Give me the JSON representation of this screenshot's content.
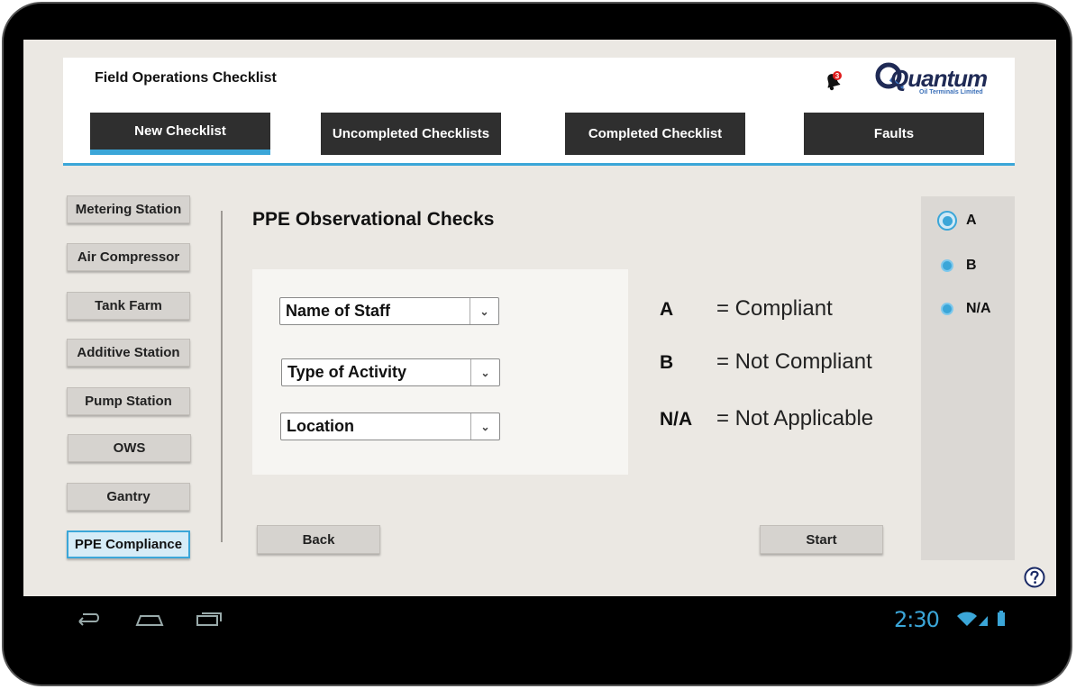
{
  "app": {
    "title": "Field Operations Checklist"
  },
  "logo": {
    "text": "Quantum",
    "subtitle": "Oil Terminals Limited"
  },
  "notifications": {
    "count": "3"
  },
  "tabs": [
    {
      "label": "New Checklist"
    },
    {
      "label": "Uncompleted Checklists"
    },
    {
      "label": "Completed Checklist"
    },
    {
      "label": "Faults"
    }
  ],
  "sidebar": {
    "items": [
      {
        "label": "Metering Station"
      },
      {
        "label": "Air Compressor"
      },
      {
        "label": "Tank Farm"
      },
      {
        "label": "Additive Station"
      },
      {
        "label": "Pump Station"
      },
      {
        "label": "OWS"
      },
      {
        "label": "Gantry"
      },
      {
        "label": "PPE Compliance"
      }
    ]
  },
  "main": {
    "title": "PPE Observational Checks",
    "selects": [
      {
        "value": "Name of Staff"
      },
      {
        "value": "Type of Activity"
      },
      {
        "value": "Location"
      }
    ],
    "legend": [
      {
        "key": "A",
        "value": "= Compliant"
      },
      {
        "key": "B",
        "value": "= Not Compliant"
      },
      {
        "key": "N/A",
        "value": "= Not Applicable"
      }
    ],
    "back_label": "Back",
    "start_label": "Start"
  },
  "rating": {
    "options": [
      {
        "label": "A",
        "selected": true
      },
      {
        "label": "B",
        "selected": false
      },
      {
        "label": "N/A",
        "selected": false
      }
    ]
  },
  "status_bar": {
    "time": "2:30"
  },
  "colors": {
    "accent": "#3ba6d8",
    "tab_bg": "#2f2f2f",
    "screen_bg": "#ebe8e3"
  }
}
